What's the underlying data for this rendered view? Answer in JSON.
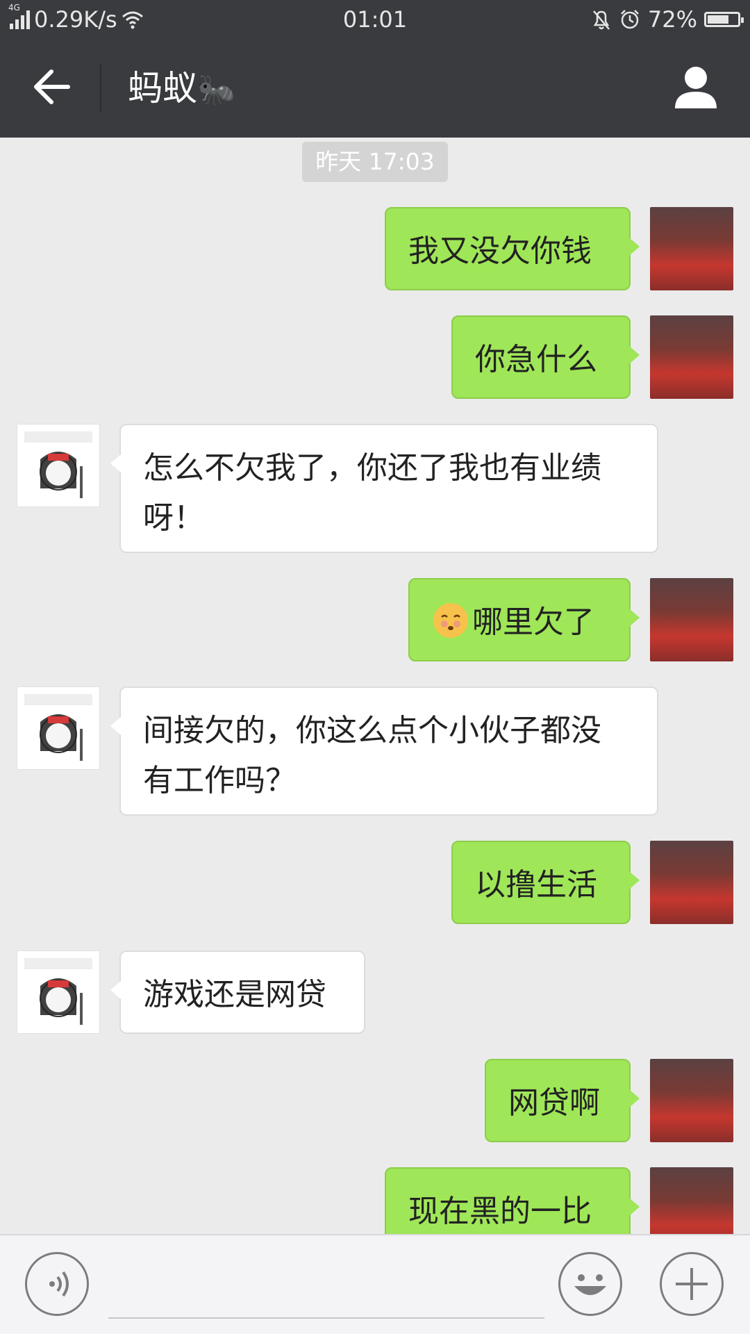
{
  "status_bar": {
    "network_type": "4G",
    "speed": "0.29K/s",
    "time": "01:01",
    "battery_percent": "72%",
    "battery_level": 0.72,
    "icons": [
      "signal-icon",
      "wifi-icon",
      "mute-bell-icon",
      "alarm-icon",
      "battery-icon"
    ]
  },
  "header": {
    "title": "蚂蚁",
    "title_emoji": "🐜",
    "back_icon": "arrow-left-icon",
    "profile_icon": "person-icon",
    "background": "#3a3b3f"
  },
  "chat": {
    "timestamp": "昨天 17:03",
    "messages": [
      {
        "side": "sent",
        "text": "我又没欠你钱"
      },
      {
        "side": "sent",
        "text": "你急什么"
      },
      {
        "side": "received",
        "text_line1": "怎么不欠我了，你还了我也有业绩",
        "text_line2": "呀！"
      },
      {
        "side": "sent",
        "emoji": "shushing-face-icon",
        "text": "哪里欠了"
      },
      {
        "side": "received",
        "text_line1": "间接欠的，你这么点个小伙子都没",
        "text_line2": "有工作吗？"
      },
      {
        "side": "sent",
        "text": "以撸生活"
      },
      {
        "side": "received",
        "text": "游戏还是网贷"
      },
      {
        "side": "sent",
        "text": "网贷啊"
      },
      {
        "side": "sent",
        "text": "现在黑的一比"
      }
    ],
    "colors": {
      "sent_bubble": "#9fe658",
      "received_bubble": "#ffffff",
      "background": "#ebebeb"
    }
  },
  "input_bar": {
    "voice_icon": "voice-icon",
    "emoji_icon": "smiley-icon",
    "plus_icon": "plus-icon",
    "placeholder": ""
  }
}
